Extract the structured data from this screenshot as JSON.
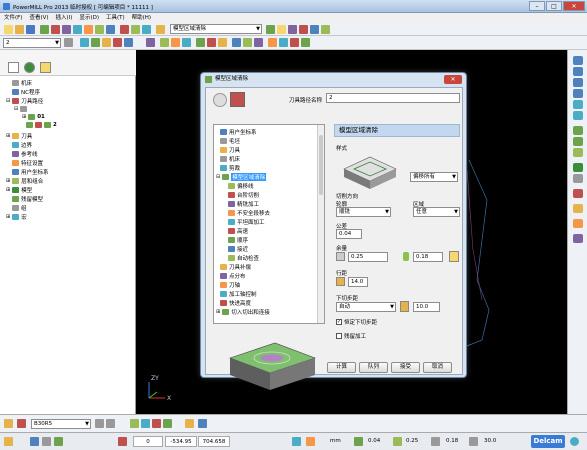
{
  "app": {
    "title": "PowerMILL Pro 2013 临时授权  [ 可编辑项目 * 11111 ]"
  },
  "menu": [
    "文件(F)",
    "查看(V)",
    "插入(I)",
    "显示(D)",
    "工具(T)",
    "帮助(H)"
  ],
  "toolbar": {
    "combo_left_value": "2",
    "toolpath_combo_value": "模型区域清除"
  },
  "explorer": {
    "items": [
      {
        "label": "机床",
        "indent": 0
      },
      {
        "label": "NC程序",
        "indent": 0
      },
      {
        "label": "刀具路径",
        "indent": 0
      },
      {
        "label": "",
        "indent": 1
      },
      {
        "label": "01",
        "indent": 2
      },
      {
        "label": "2",
        "indent": 2
      },
      {
        "label": "刀具",
        "indent": 0
      },
      {
        "label": "边界",
        "indent": 0
      },
      {
        "label": "参考线",
        "indent": 0
      },
      {
        "label": "特征设置",
        "indent": 0
      },
      {
        "label": "用户坐标系",
        "indent": 0
      },
      {
        "label": "层和组合",
        "indent": 0
      },
      {
        "label": "模型",
        "indent": 0
      },
      {
        "label": "残留模型",
        "indent": 0
      },
      {
        "label": "组",
        "indent": 0
      },
      {
        "label": "宏",
        "indent": 0
      }
    ]
  },
  "dialog": {
    "title": "模型区域清除",
    "toolpath_name_label": "刀具路径名称",
    "toolpath_name_value": "2",
    "section_header": "模型区域清除",
    "tree": [
      {
        "label": "用户坐标系",
        "indent": 0
      },
      {
        "label": "毛坯",
        "indent": 0
      },
      {
        "label": "刀具",
        "indent": 0
      },
      {
        "label": "机床",
        "indent": 0
      },
      {
        "label": "剪裁",
        "indent": 0
      },
      {
        "label": "模型区域清除",
        "indent": 0,
        "selected": true
      },
      {
        "label": "偏移线",
        "indent": 1
      },
      {
        "label": "台阶切削",
        "indent": 1
      },
      {
        "label": "精铣加工",
        "indent": 1
      },
      {
        "label": "不安全段移去",
        "indent": 1
      },
      {
        "label": "平坦面加工",
        "indent": 1
      },
      {
        "label": "高速",
        "indent": 1
      },
      {
        "label": "顺序",
        "indent": 1
      },
      {
        "label": "接近",
        "indent": 1
      },
      {
        "label": "自动检查",
        "indent": 1
      },
      {
        "label": "刀具补偿",
        "indent": 0
      },
      {
        "label": "点分布",
        "indent": 0
      },
      {
        "label": "刀轴",
        "indent": 0
      },
      {
        "label": "加工轴控制",
        "indent": 0
      },
      {
        "label": "快进高度",
        "indent": 0
      },
      {
        "label": "切入切出和连接",
        "indent": 0
      }
    ],
    "style_label": "样式",
    "style_value": "偏移所有",
    "cut_direction_label": "切削方向",
    "profile_label": "轮廓",
    "profile_value": "顺铣",
    "area_label": "区域",
    "area_value": "任意",
    "tolerance_label": "公差",
    "tolerance_value": "0.04",
    "allowance_label": "余量",
    "allowance_value": "0.25",
    "axial_allowance_value": "0.18",
    "stepover_label": "行距",
    "stepover_value": "14.0",
    "stepdown_label": "下切步距",
    "stepdown_mode": "自动",
    "stepdown_value": "10.0",
    "constant_stepdown_label": "恒定下切步距",
    "constant_stepdown_checked": true,
    "rest_label": "残留加工",
    "rest_checked": false,
    "buttons": {
      "calculate": "计算",
      "queue": "队列",
      "accept": "接受",
      "cancel": "取消"
    }
  },
  "bottom": {
    "tool_label": "B30R5"
  },
  "status": {
    "x": "0",
    "y": "-534.95",
    "z": "704.658",
    "units": "mm",
    "tol": "0.04",
    "allow": "0.25",
    "axial": "0.18",
    "dia": "30.0",
    "brand": "Delcam"
  }
}
